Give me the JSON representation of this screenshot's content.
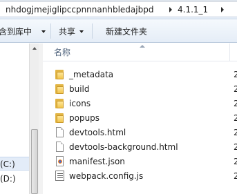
{
  "address_bar": {
    "crumbs": [
      "nhdogjmejiglipccpnnnanhbledajbpd",
      "4.1.1_1"
    ]
  },
  "toolbar": {
    "include_in_library_label": "含到库中",
    "share_label": "共享",
    "new_folder_label": "新建文件夹"
  },
  "nav_pane": {
    "items": [
      {
        "label": "(C:)",
        "selected": true
      },
      {
        "label": "(D:)",
        "selected": false
      }
    ]
  },
  "file_list": {
    "column_name": "名称",
    "cut_text": "2",
    "items": [
      {
        "name": "_metadata",
        "type": "folder"
      },
      {
        "name": "build",
        "type": "folder"
      },
      {
        "name": "icons",
        "type": "folder"
      },
      {
        "name": "popups",
        "type": "folder"
      },
      {
        "name": "devtools.html",
        "type": "html-file"
      },
      {
        "name": "devtools-background.html",
        "type": "html-file"
      },
      {
        "name": "manifest.json",
        "type": "json-file"
      },
      {
        "name": "webpack.config.js",
        "type": "js-file"
      }
    ]
  },
  "colors": {
    "toolbar_bg": "#e5edf7",
    "selection_bg": "#e3ecf8",
    "folder_yellow": "#f2c54d",
    "header_text": "#4c607a"
  }
}
